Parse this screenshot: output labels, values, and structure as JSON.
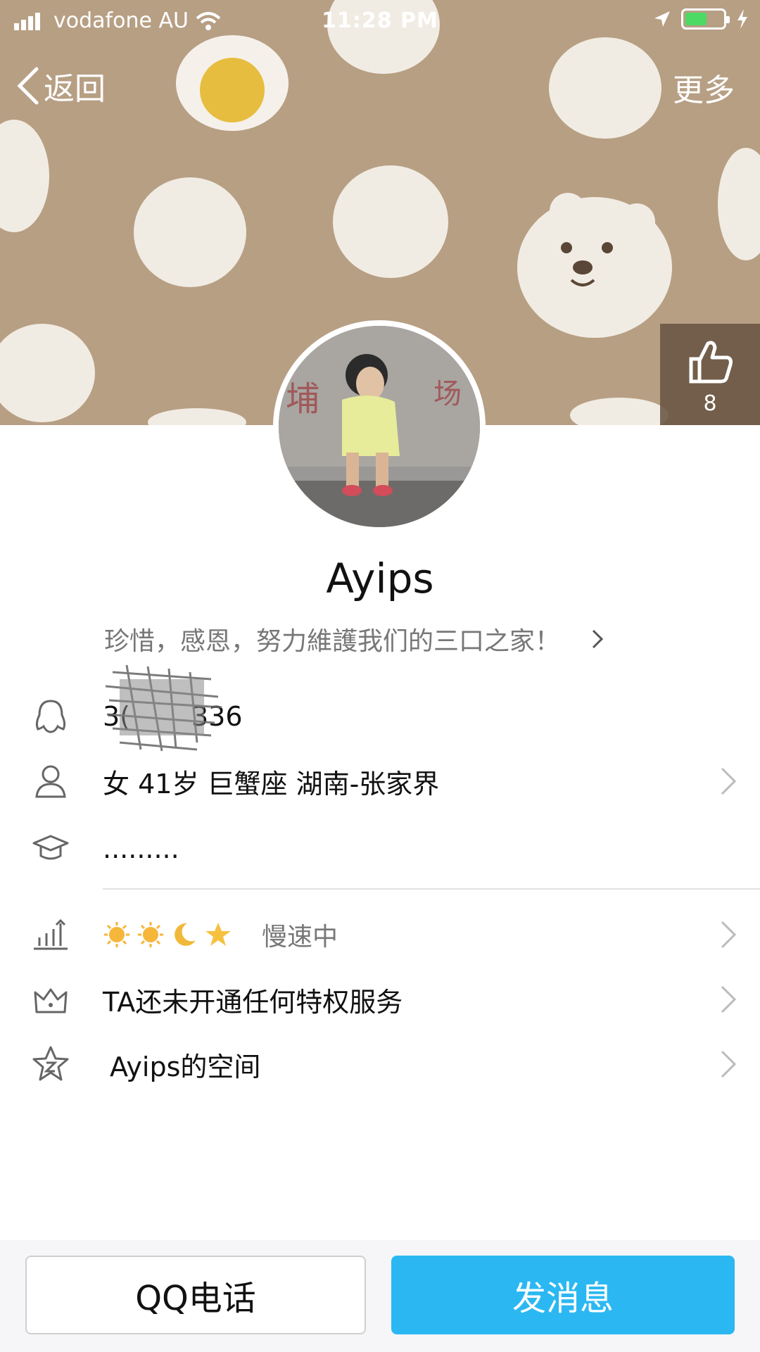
{
  "status_bar": {
    "carrier": "vodafone AU",
    "time": "11:28 PM"
  },
  "nav": {
    "back_label": "返回",
    "more_label": "更多"
  },
  "likes": {
    "count": "8"
  },
  "profile": {
    "name": "Ayips",
    "signature": "珍惜，感恩，努力維護我们的三口之家！"
  },
  "info": {
    "qq_number_visible_prefix": "3(",
    "qq_number_visible_suffix": "336",
    "personal": "女 41岁 巨蟹座 湖南-张家界",
    "education": ".........",
    "level_status": "慢速中",
    "privilege": "TA还未开通任何特权服务",
    "space": "Ayips的空间"
  },
  "level_icons": [
    "sun-icon",
    "sun-icon",
    "moon-icon",
    "star-icon"
  ],
  "actions": {
    "call_label": "QQ电话",
    "message_label": "发消息"
  },
  "colors": {
    "cover_bg": "#b79f84",
    "message_button": "#2bb8f2",
    "battery_fill": "#4cd964"
  }
}
